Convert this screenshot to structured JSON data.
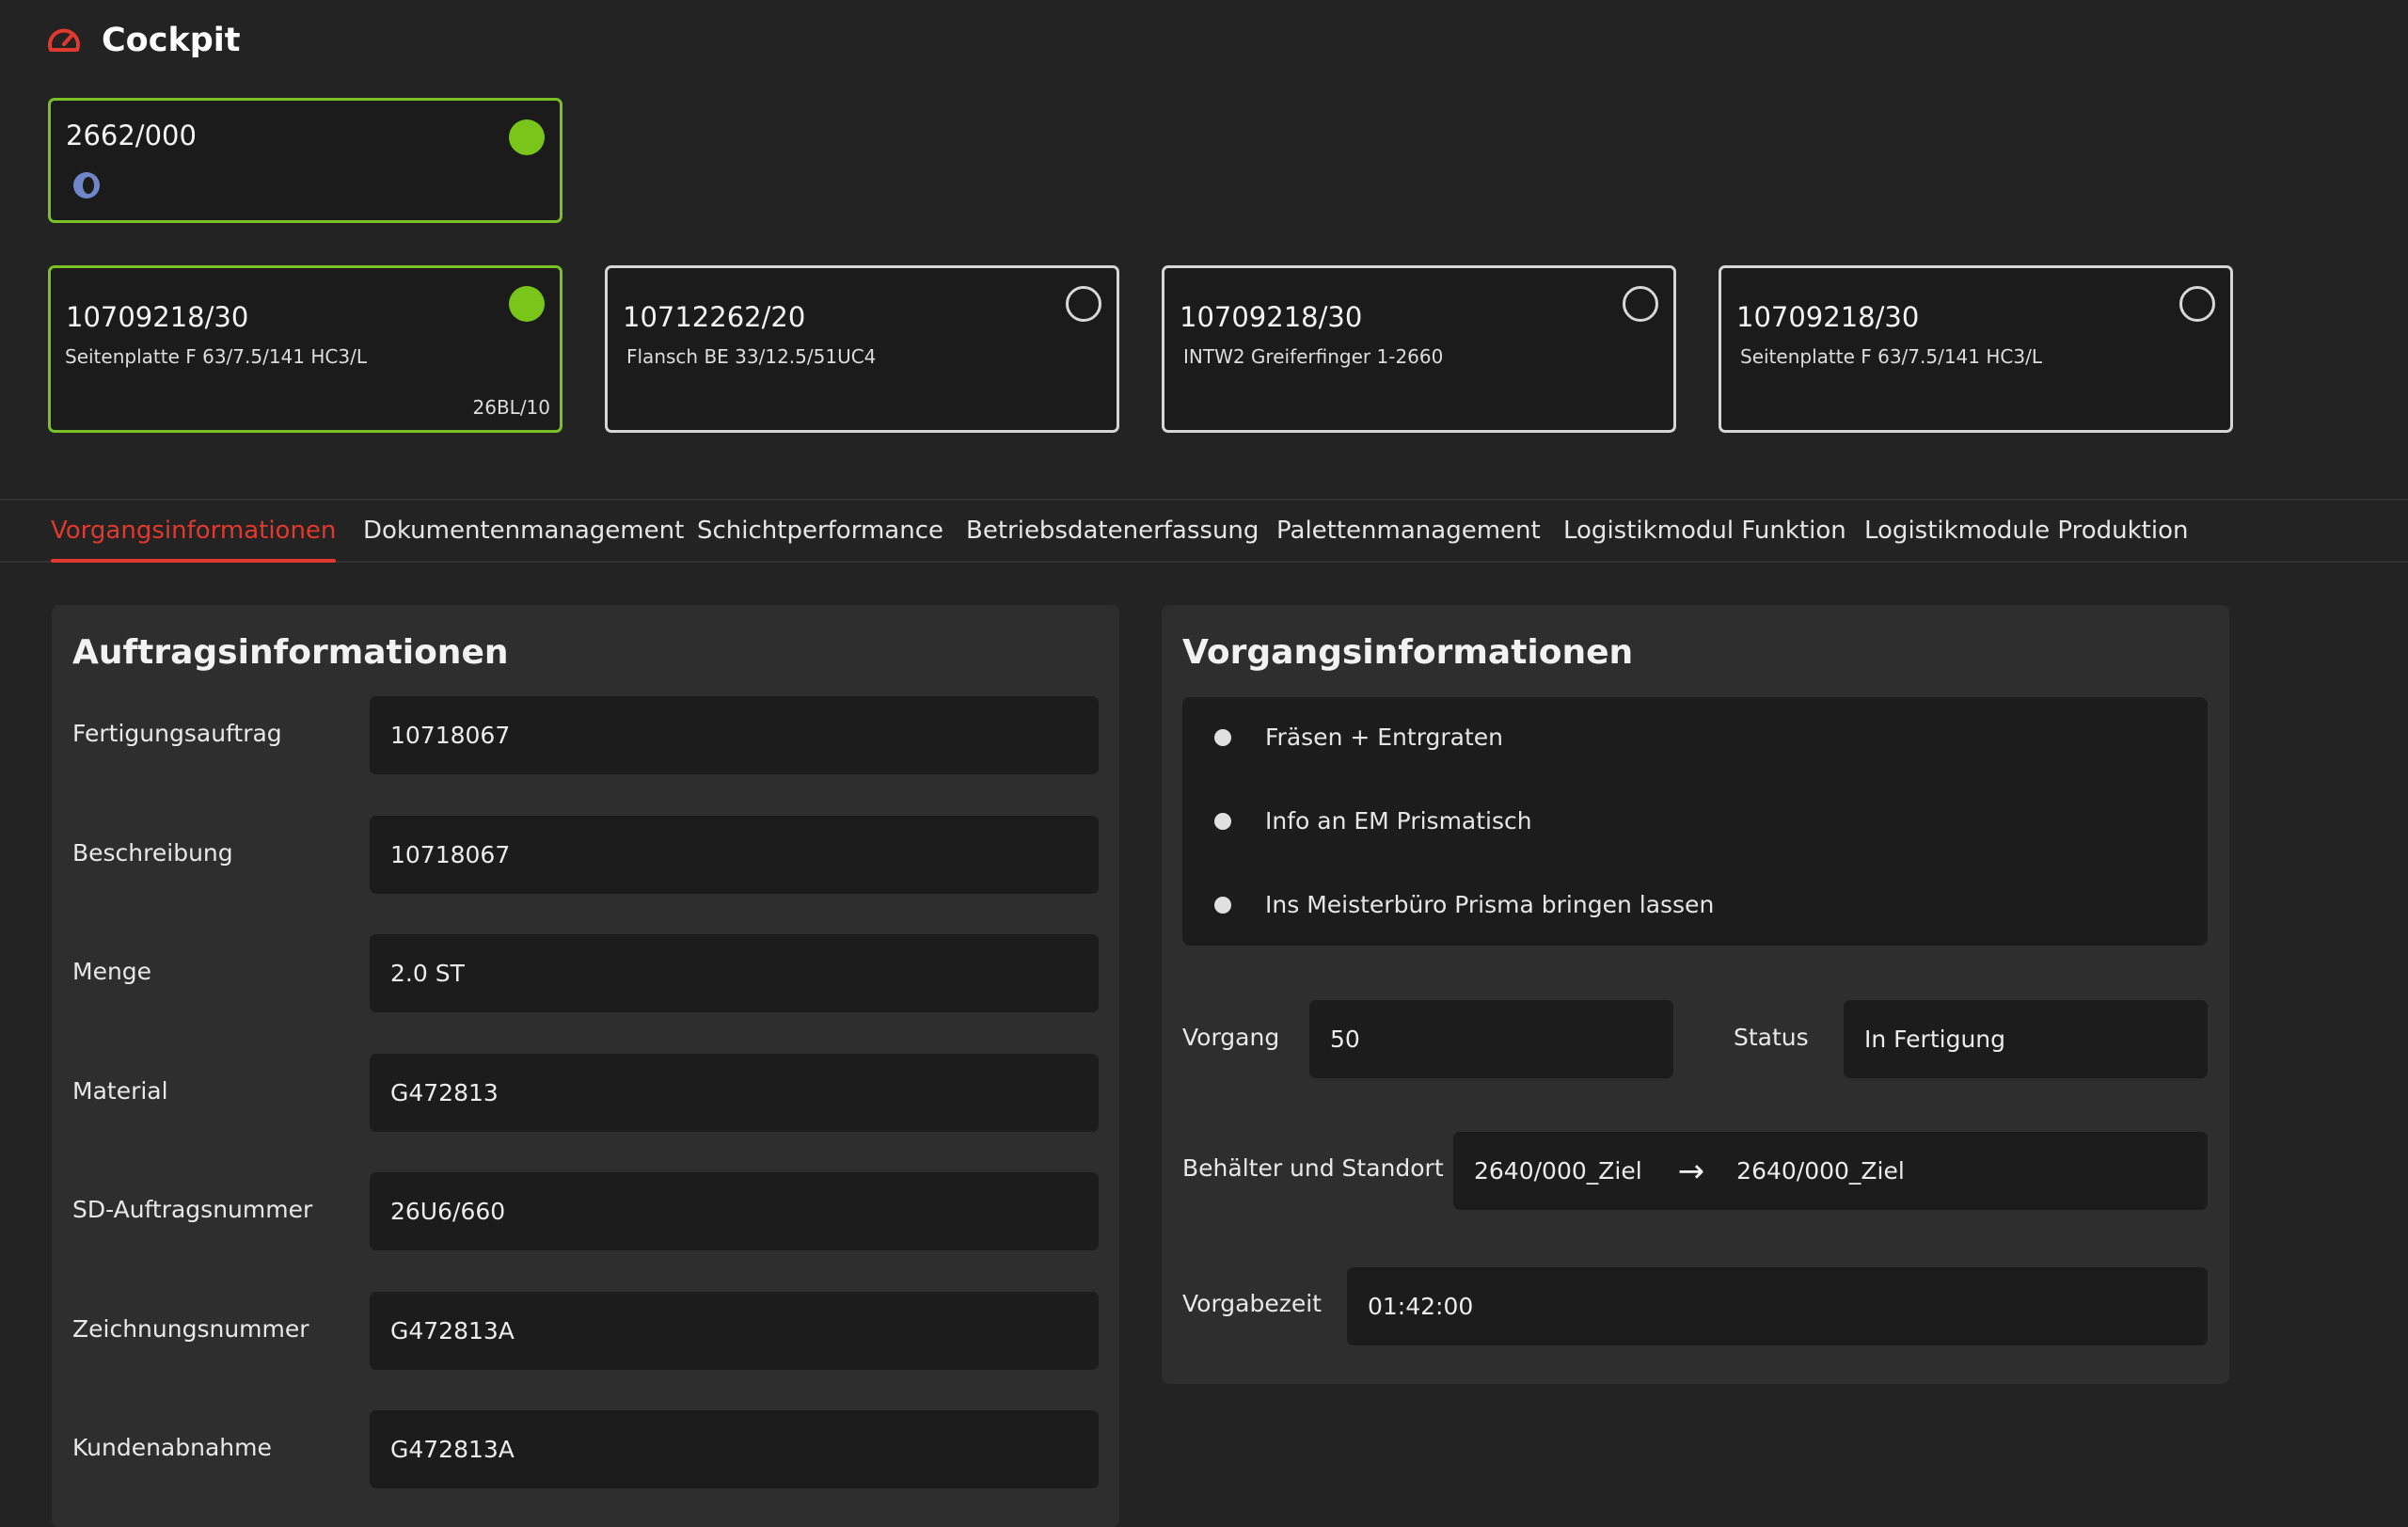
{
  "app": {
    "title": "Cockpit",
    "logo_icon": "speedometer-icon",
    "accent": "#e0392d"
  },
  "workstation": {
    "code": "2662/000",
    "status_icon": "loading-ring-icon",
    "status_color": "#7ac51a"
  },
  "orders": [
    {
      "code": "10709218/30",
      "desc": "Seitenplatte F 63/7.5/141 HC3/L",
      "note": "26BL/10",
      "active": true
    },
    {
      "code": "10712262/20",
      "desc": "Flansch BE 33/12.5/51UC4",
      "note": "",
      "active": false
    },
    {
      "code": "10709218/30",
      "desc": "INTW2 Greiferfinger 1-2660",
      "note": "",
      "active": false
    },
    {
      "code": "10709218/30",
      "desc": "Seitenplatte F 63/7.5/141 HC3/L",
      "note": "",
      "active": false
    }
  ],
  "tabs": [
    {
      "label": "Vorgangsinformationen",
      "active": true
    },
    {
      "label": "Dokumentenmanagement"
    },
    {
      "label": "Schichtperformance"
    },
    {
      "label": "Betriebsdatenerfassung"
    },
    {
      "label": "Palettenmanagement"
    },
    {
      "label": "Logistikmodul Funktion"
    },
    {
      "label": "Logistikmodule Produktion"
    }
  ],
  "auftrag": {
    "title": "Auftragsinformationen",
    "fields": [
      {
        "label": "Fertigungsauftrag",
        "value": "10718067"
      },
      {
        "label": "Beschreibung",
        "value": "10718067"
      },
      {
        "label": "Menge",
        "value": "2.0 ST"
      },
      {
        "label": "Material",
        "value": "G472813"
      },
      {
        "label": "SD-Auftragsnummer",
        "value": "26U6/660"
      },
      {
        "label": "Zeichnungsnummer",
        "value": "G472813A"
      },
      {
        "label": "Kundenabnahme",
        "value": "G472813A"
      }
    ]
  },
  "vorgang": {
    "title": "Vorgangsinformationen",
    "bullets": [
      "Fräsen + Entrgraten",
      "Info an EM Prismatisch",
      "Ins Meisterbüro Prisma bringen lassen"
    ],
    "vorgang_label": "Vorgang",
    "vorgang_value": "50",
    "status_label": "Status",
    "status_value": "In Fertigung",
    "behaelter_label": "Behälter und Standort",
    "behaelter_from": "2640/000_Ziel",
    "behaelter_to": "2640/000_Ziel",
    "arrow_icon": "arrow-right-icon",
    "vorgabezeit_label": "Vorgabezeit",
    "vorgabezeit_value": "01:42:00"
  }
}
